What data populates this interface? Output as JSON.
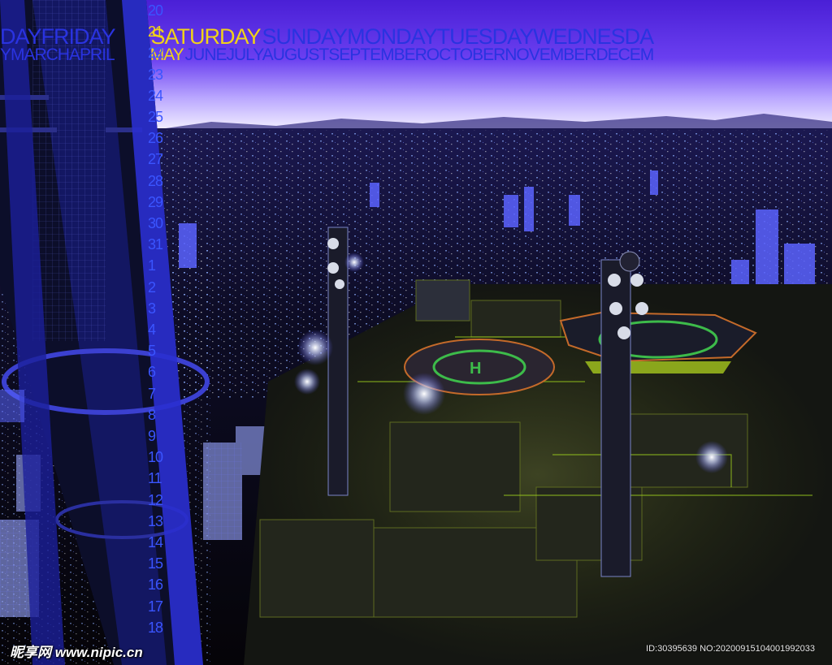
{
  "calendar": {
    "days": [
      "DAY",
      "FRIDAY",
      "SATURDAY",
      "SUNDAY",
      "MONDAY",
      "TUESDAY",
      "WEDNESDA"
    ],
    "selected_day_index": 2,
    "months": [
      "Y",
      "MARCH",
      "APRIL",
      "MAY",
      "JUNE",
      "JULY",
      "AUGUST",
      "SEPTEMBER",
      "OCTOBER",
      "NOVEMBER",
      "DECEM"
    ],
    "selected_month_index": 3,
    "dates": [
      "20",
      "21",
      "22",
      "23",
      "24",
      "25",
      "26",
      "27",
      "28",
      "29",
      "30",
      "31",
      "1",
      "2",
      "3",
      "4",
      "5",
      "6",
      "7",
      "8",
      "9",
      "10",
      "11",
      "12",
      "13",
      "14",
      "15",
      "16",
      "17",
      "18"
    ],
    "selected_date_index": 1,
    "colors": {
      "dim": "#2a33e0",
      "highlight": "#f0d21a",
      "numbers": "#3a55ff"
    }
  },
  "watermark": {
    "left_text": "昵享网 www.nipic.cn",
    "right_text": "ID:30395639 NO:20200915104001992033"
  },
  "scene_elements": [
    "tower-structure",
    "city-lights",
    "helipad",
    "helipad",
    "antenna-mast",
    "antenna-mast"
  ]
}
